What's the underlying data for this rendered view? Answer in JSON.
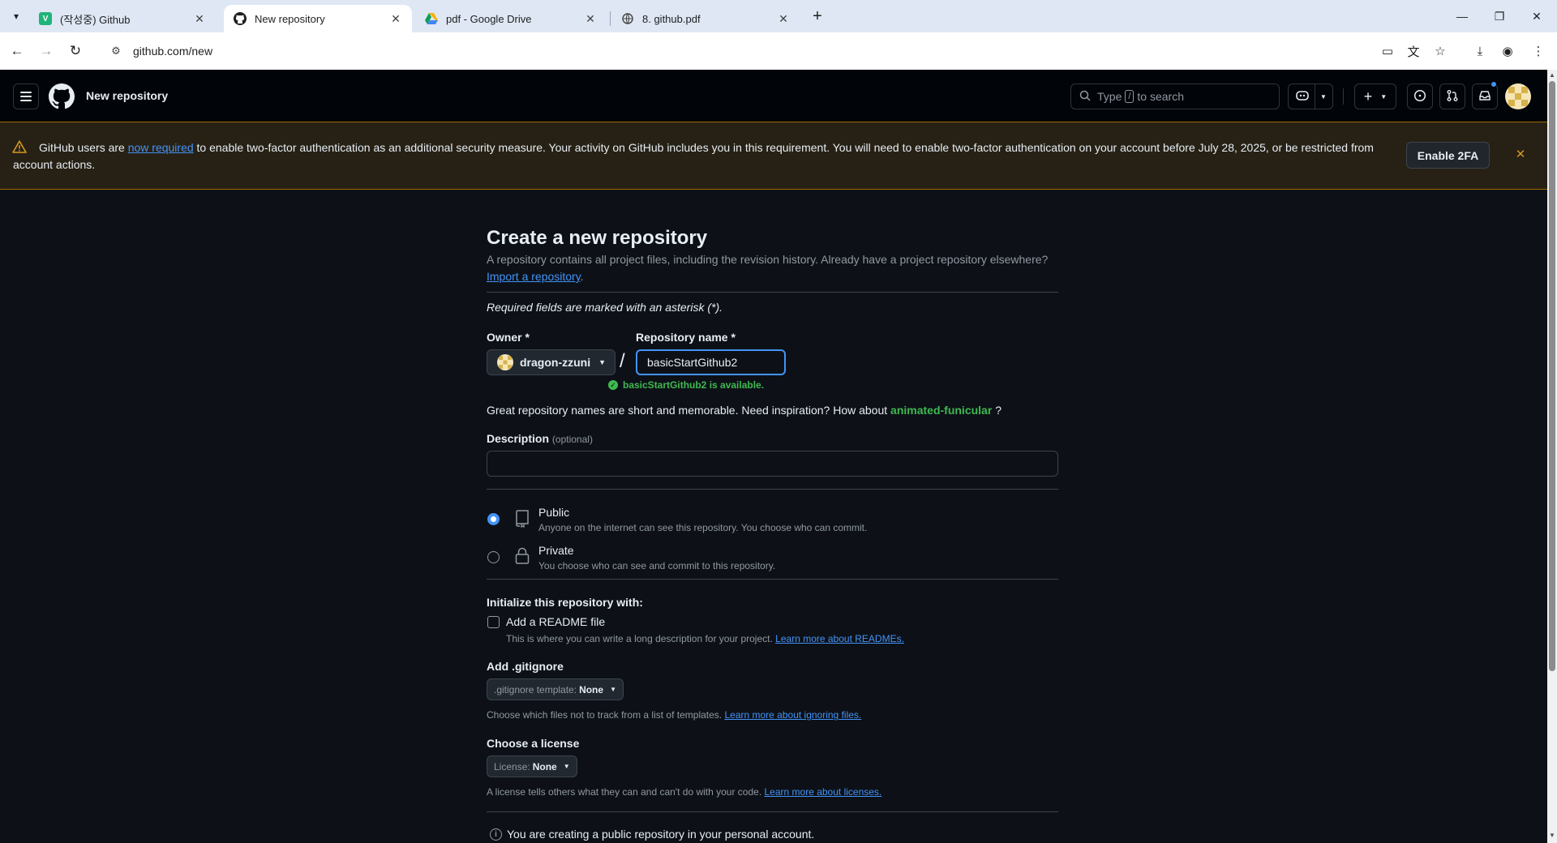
{
  "browser": {
    "tabs": [
      {
        "title": "(작성중) Github",
        "favicon": "v-icon"
      },
      {
        "title": "New repository",
        "favicon": "github-icon"
      },
      {
        "title": "pdf - Google Drive",
        "favicon": "drive-icon"
      },
      {
        "title": "8. github.pdf",
        "favicon": "globe-icon"
      }
    ],
    "url": "github.com/new"
  },
  "header": {
    "title": "New repository",
    "search_prefix": "Type",
    "search_key": "/",
    "search_suffix": "to search"
  },
  "banner": {
    "text_before": "GitHub users are ",
    "link": "now required",
    "text_after": " to enable two-factor authentication as an additional security measure. Your activity on GitHub includes you in this requirement. You will need to enable two-factor authentication on your account before July 28, 2025, or be restricted from account actions.",
    "button": "Enable 2FA"
  },
  "form": {
    "title": "Create a new repository",
    "subtitle": "A repository contains all project files, including the revision history. Already have a project repository elsewhere?",
    "import_link": "Import a repository",
    "import_suffix": ".",
    "required_note": "Required fields are marked with an asterisk (*).",
    "owner_label": "Owner *",
    "owner_value": "dragon-zzuni",
    "slash": "/",
    "repo_label": "Repository name *",
    "repo_value": "basicStartGithub2",
    "availability": "basicStartGithub2 is available.",
    "inspire_text": "Great repository names are short and memorable. Need inspiration? How about",
    "inspire_suggestion": "animated-funicular",
    "inspire_end": "?",
    "description_label": "Description",
    "description_optional": "(optional)",
    "description_value": "",
    "visibility": [
      {
        "title": "Public",
        "desc": "Anyone on the internet can see this repository. You choose who can commit.",
        "selected": true
      },
      {
        "title": "Private",
        "desc": "You choose who can see and commit to this repository.",
        "selected": false
      }
    ],
    "init_title": "Initialize this repository with:",
    "readme_label": "Add a README file",
    "readme_checked": false,
    "readme_note": "This is where you can write a long description for your project.",
    "readme_link": "Learn more about READMEs.",
    "gitignore_title": "Add .gitignore",
    "gitignore_select_prefix": ".gitignore template:",
    "gitignore_select_value": "None",
    "gitignore_note": "Choose which files not to track from a list of templates.",
    "gitignore_link": "Learn more about ignoring files.",
    "license_title": "Choose a license",
    "license_select_prefix": "License:",
    "license_select_value": "None",
    "license_note": "A license tells others what they can and can't do with your code.",
    "license_link": "Learn more about licenses.",
    "info": "You are creating a public repository in your personal account."
  },
  "colors": {
    "accent": "#4493f8",
    "success": "#3fb950",
    "warning_border": "#9e6a03",
    "background": "#0d1117"
  }
}
